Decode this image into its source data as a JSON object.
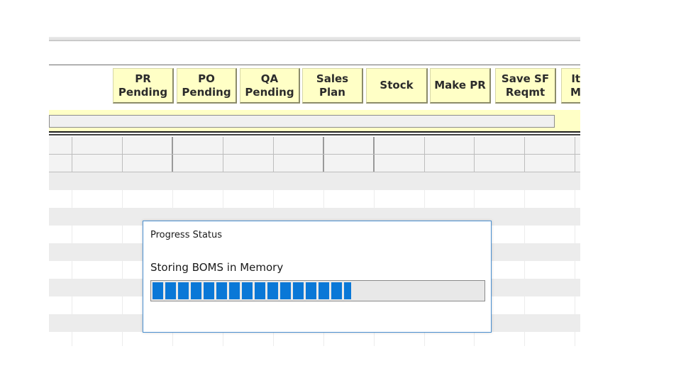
{
  "toolbar": {
    "buttons": [
      {
        "id": "pr-pending",
        "label": "PR\nPending"
      },
      {
        "id": "po-pending",
        "label": "PO\nPending"
      },
      {
        "id": "qa-pending",
        "label": "QA\nPending"
      },
      {
        "id": "sales-plan",
        "label": "Sales\nPlan"
      },
      {
        "id": "stock",
        "label": "Stock"
      },
      {
        "id": "make-pr",
        "label": "Make PR"
      },
      {
        "id": "save-sf-reqmt",
        "label": "Save  SF\nReqmt"
      },
      {
        "id": "item-mu",
        "label": "Ite\nMu"
      }
    ]
  },
  "dialog": {
    "title": "Progress Status",
    "message": "Storing BOMS in Memory",
    "progress_fraction": 0.6
  },
  "colors": {
    "toolbar_bg": "#ffffc6",
    "progress_fill": "#0a78d7",
    "dialog_border": "#4a8fd0"
  }
}
